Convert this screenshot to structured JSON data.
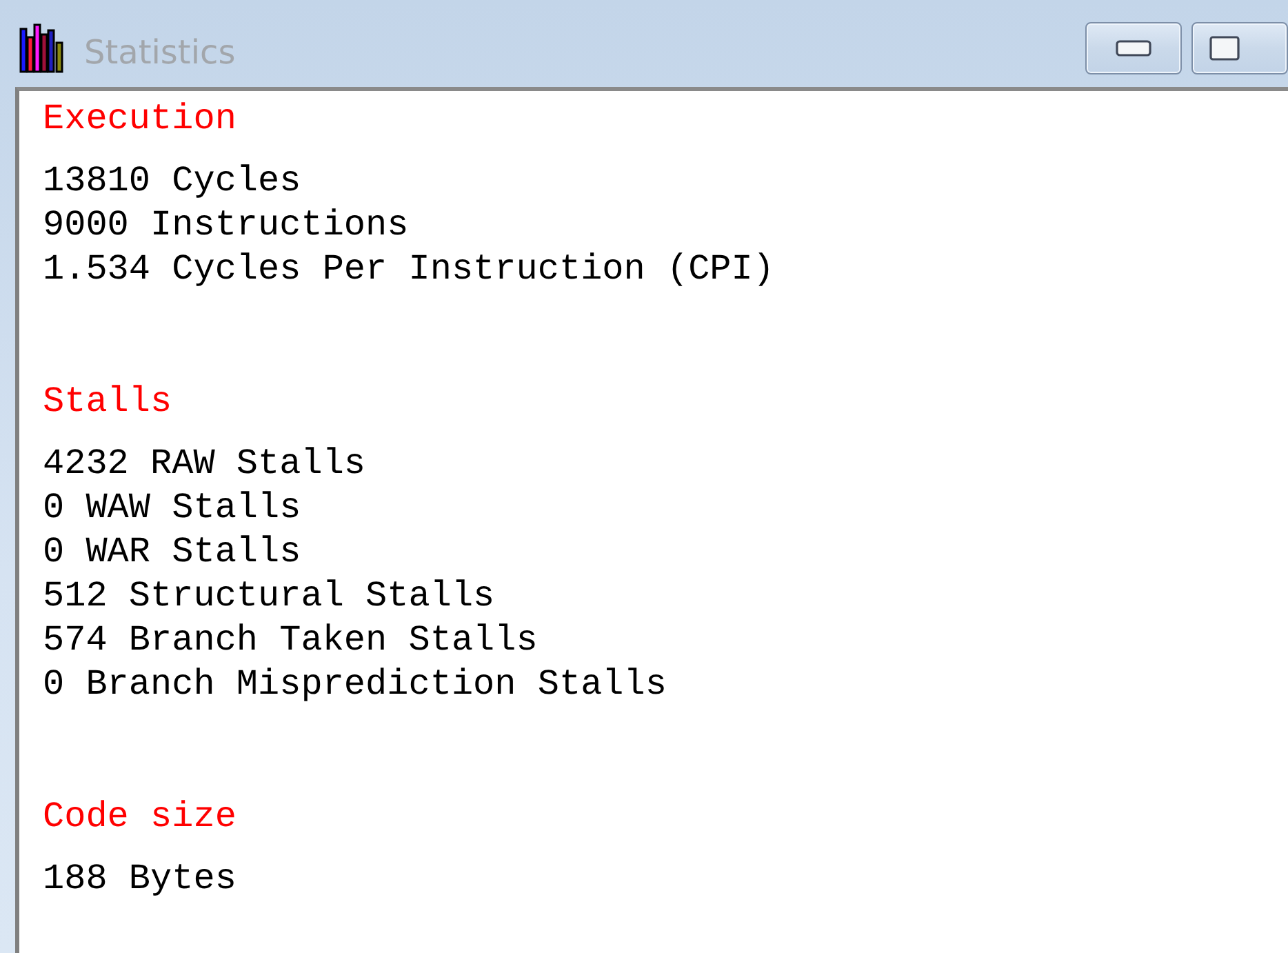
{
  "window": {
    "title": "Statistics"
  },
  "sections": [
    {
      "heading": "Execution",
      "lines": [
        "13810 Cycles",
        "9000 Instructions",
        "1.534 Cycles Per Instruction (CPI)"
      ]
    },
    {
      "heading": "Stalls",
      "lines": [
        "4232 RAW Stalls",
        "0 WAW Stalls",
        "0 WAR Stalls",
        "512 Structural Stalls",
        "574 Branch Taken Stalls",
        "0 Branch Misprediction Stalls"
      ]
    },
    {
      "heading": "Code size",
      "lines": [
        "188 Bytes"
      ]
    }
  ]
}
